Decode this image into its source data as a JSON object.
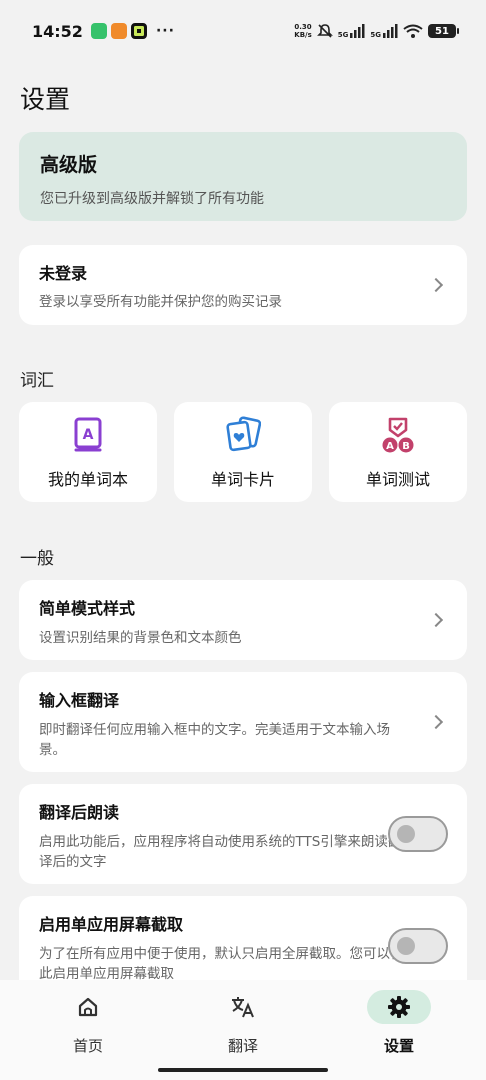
{
  "status_bar": {
    "time": "14:52",
    "dots": "···",
    "speed_value": "0.30",
    "speed_unit": "KB/s",
    "net_label_1": "5G",
    "net_label_2": "5G",
    "battery": "51"
  },
  "page_title": "设置",
  "premium": {
    "title": "高级版",
    "subtitle": "您已升级到高级版并解锁了所有功能"
  },
  "account": {
    "title": "未登录",
    "subtitle": "登录以享受所有功能并保护您的购买记录"
  },
  "vocab": {
    "section_label": "词汇",
    "items": [
      {
        "label": "我的单词本",
        "icon": "notebook-icon",
        "color": "#8a3fd1"
      },
      {
        "label": "单词卡片",
        "icon": "flashcard-icon",
        "color": "#2f7fd6"
      },
      {
        "label": "单词测试",
        "icon": "quiz-icon",
        "color": "#c2416b"
      }
    ]
  },
  "general": {
    "section_label": "一般",
    "items": [
      {
        "title": "简单模式样式",
        "subtitle": "设置识别结果的背景色和文本颜色",
        "control": "chevron"
      },
      {
        "title": "输入框翻译",
        "subtitle": "即时翻译任何应用输入框中的文字。完美适用于文本输入场景。",
        "control": "chevron"
      },
      {
        "title": "翻译后朗读",
        "subtitle": "启用此功能后，应用程序将自动使用系统的TTS引擎来朗读翻译后的文字",
        "control": "toggle",
        "enabled": false
      },
      {
        "title": "启用单应用屏幕截取",
        "subtitle": "为了在所有应用中便于使用，默认只启用全屏截取。您可以在此启用单应用屏幕截取",
        "control": "toggle",
        "enabled": false
      }
    ]
  },
  "bottom_nav": {
    "items": [
      {
        "label": "首页",
        "icon": "home-icon",
        "active": false
      },
      {
        "label": "翻译",
        "icon": "translate-icon",
        "active": false
      },
      {
        "label": "设置",
        "icon": "gear-icon",
        "active": true
      }
    ]
  },
  "colors": {
    "background": "#f2f2f2",
    "premium_bg": "#dbe9e3",
    "nav_active_bg": "#d4ece0"
  }
}
